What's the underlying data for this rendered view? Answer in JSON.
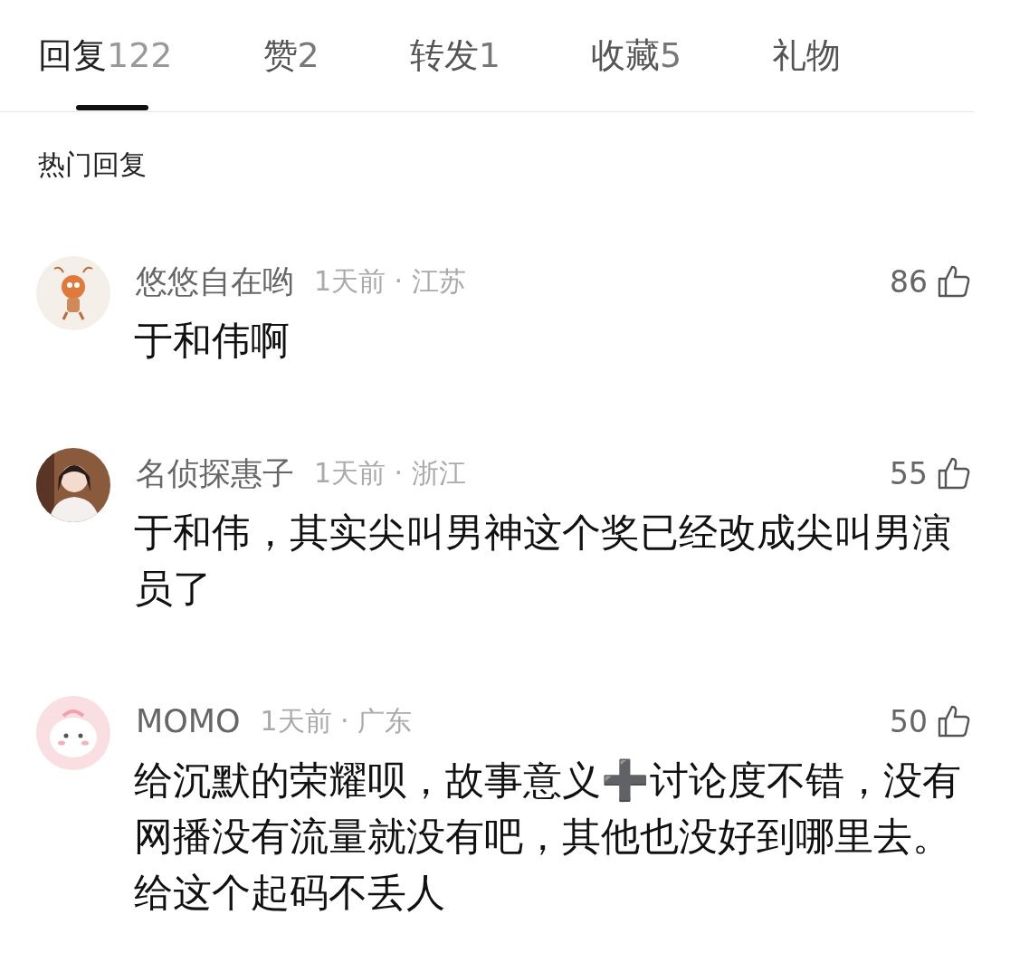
{
  "tabs": [
    {
      "label": "回复",
      "count": "122",
      "selected": true
    },
    {
      "label": "赞",
      "count": "2",
      "selected": false
    },
    {
      "label": "转发",
      "count": "1",
      "selected": false
    },
    {
      "label": "收藏",
      "count": "5",
      "selected": false
    },
    {
      "label": "礼物",
      "selected": false
    }
  ],
  "section_title": "热门回复",
  "comments": [
    {
      "user": "悠悠自在哟",
      "meta": "1天前 · 江苏",
      "likes": "86",
      "text": "于和伟啊"
    },
    {
      "user": "名侦探惠子",
      "meta": "1天前 · 浙江",
      "likes": "55",
      "text": "于和伟，其实尖叫男神这个奖已经改成尖叫男演员了"
    },
    {
      "user": "MOMO",
      "meta": "1天前 · 广东",
      "likes": "50",
      "text": "给沉默的荣耀呗，故事意义➕讨论度不错，没有网播没有流量就没有吧，其他也没好到哪里去。给这个起码不丢人"
    }
  ]
}
